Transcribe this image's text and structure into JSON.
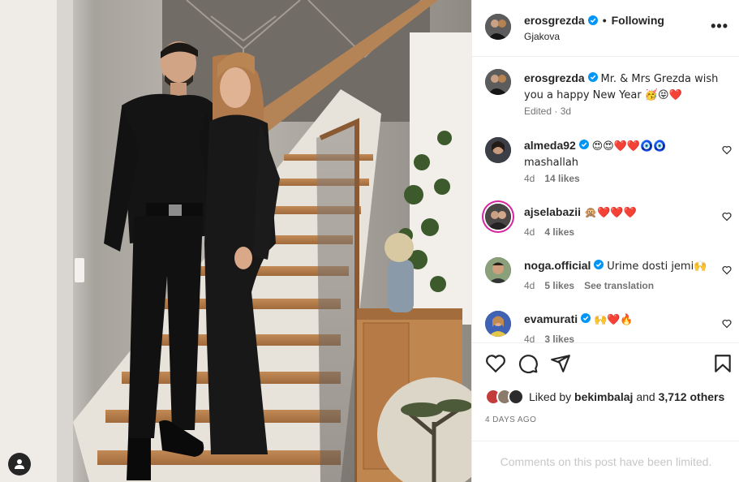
{
  "post": {
    "author": "erosgrezda",
    "follow_status": "Following",
    "separator": "•",
    "location": "Gjakova",
    "more": "•••",
    "caption_user": "erosgrezda",
    "caption_text": "Mr. & Mrs Grezda wish you a happy New Year 🥳😝❤️",
    "caption_edited": "Edited",
    "caption_age": "3d"
  },
  "comments": [
    {
      "user": "almeda92",
      "verified": true,
      "text": "😍😍❤️❤️🧿🧿 mashallah",
      "age": "4d",
      "likes": "14 likes",
      "extra": ""
    },
    {
      "user": "ajselabazii",
      "verified": false,
      "text": "🙊❤️❤️❤️",
      "age": "4d",
      "likes": "4 likes",
      "extra": ""
    },
    {
      "user": "noga.official",
      "verified": true,
      "text": "Urime dosti jemi🙌",
      "age": "4d",
      "likes": "5 likes",
      "extra": "See translation"
    },
    {
      "user": "evamurati",
      "verified": true,
      "text": "🙌❤️🔥",
      "age": "4d",
      "likes": "3 likes",
      "extra": ""
    }
  ],
  "likes": {
    "prefix": "Liked by",
    "user": "bekimbalaj",
    "mid": "and",
    "count": "3,712 others"
  },
  "date": "4 DAYS AGO",
  "footer": "Comments on this post have been limited.",
  "icons": {
    "verified": "verified-badge-icon",
    "like": "heart-icon",
    "comment": "comment-icon",
    "share": "send-icon",
    "save": "bookmark-icon",
    "tag": "user-tag-icon"
  },
  "colors": {
    "verified": "#0095f6",
    "muted": "#737373",
    "border": "#efefef",
    "footer_text": "#c7c7c7"
  }
}
